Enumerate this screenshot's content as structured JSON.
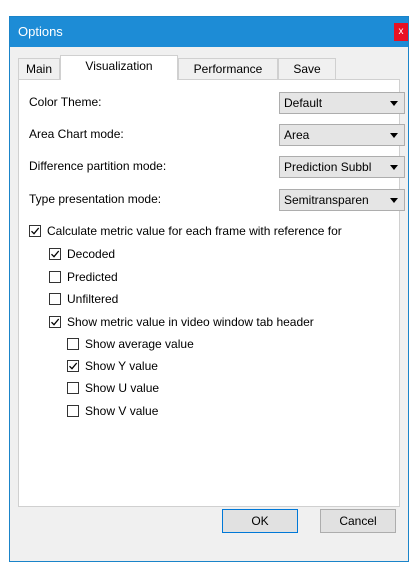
{
  "window": {
    "title": "Options",
    "close_glyph": "x"
  },
  "tabs": [
    {
      "label": "Main",
      "active": false
    },
    {
      "label": "Visualization",
      "active": true
    },
    {
      "label": "Performance",
      "active": false
    },
    {
      "label": "Save",
      "active": false
    }
  ],
  "fields": [
    {
      "label": "Color Theme:",
      "value": "Default"
    },
    {
      "label": "Area Chart mode:",
      "value": "Area"
    },
    {
      "label": "Difference partition mode:",
      "value": "Prediction Subbl"
    },
    {
      "label": "Type presentation mode:",
      "value": "Semitransparen"
    }
  ],
  "checkboxes": [
    {
      "label": "Calculate metric value for each frame with reference for",
      "checked": true
    },
    {
      "label": "Decoded",
      "checked": true
    },
    {
      "label": "Predicted",
      "checked": false
    },
    {
      "label": "Unfiltered",
      "checked": false
    },
    {
      "label": "Show metric value in video window tab header",
      "checked": true
    },
    {
      "label": "Show average value",
      "checked": false
    },
    {
      "label": "Show Y value",
      "checked": true
    },
    {
      "label": "Show U value",
      "checked": false
    },
    {
      "label": "Show V value",
      "checked": false
    }
  ],
  "buttons": {
    "ok": "OK",
    "cancel": "Cancel"
  },
  "colors": {
    "titlebar": "#1d8cd6",
    "close": "#e81123",
    "default_border": "#0078d7"
  }
}
